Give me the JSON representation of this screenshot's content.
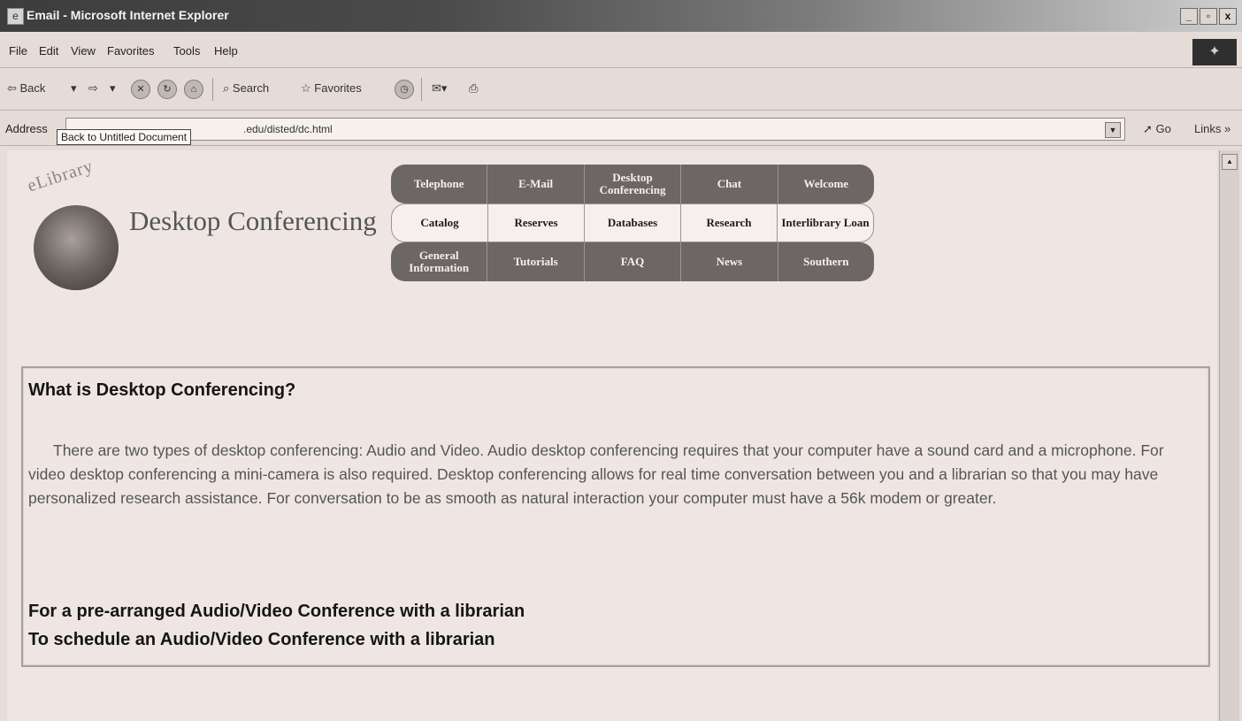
{
  "window": {
    "title": "Email - Microsoft Internet Explorer",
    "buttons": [
      "_",
      "▫",
      "x"
    ]
  },
  "menu": [
    "File",
    "Edit",
    "View",
    "Favorites",
    "Tools",
    "Help"
  ],
  "toolbar": {
    "back": "Back",
    "search": "Search",
    "favorites": "Favorites"
  },
  "address": {
    "label": "Address",
    "url": ".edu/disted/dc.html",
    "go": "Go",
    "links": "Links"
  },
  "tooltip": "Back to Untitled Document",
  "logo": {
    "arc": "eLibrary",
    "title": "Desktop Conferencing"
  },
  "nav": {
    "row1": [
      "Telephone",
      "E-Mail",
      "Desktop Conferencing",
      "Chat",
      "Welcome"
    ],
    "row2": [
      "Catalog",
      "Reserves",
      "Databases",
      "Research",
      "Interlibrary Loan"
    ],
    "row3": [
      "General Information",
      "Tutorials",
      "FAQ",
      "News",
      "Southern"
    ]
  },
  "content": {
    "heading": "What is Desktop Conferencing?",
    "paragraph": "There are two types of desktop conferencing: Audio and Video. Audio desktop conferencing requires that your computer have a sound card and a microphone. For video desktop conferencing a mini-camera is also required. Desktop conferencing allows for real time conversation between you and a librarian so that you may have personalized research assistance. For conversation to be as smooth as natural interaction your computer must have a 56k modem or greater.",
    "link1": "For a pre-arranged Audio/Video Conference with a librarian",
    "link2": "To schedule an Audio/Video Conference with a librarian"
  }
}
